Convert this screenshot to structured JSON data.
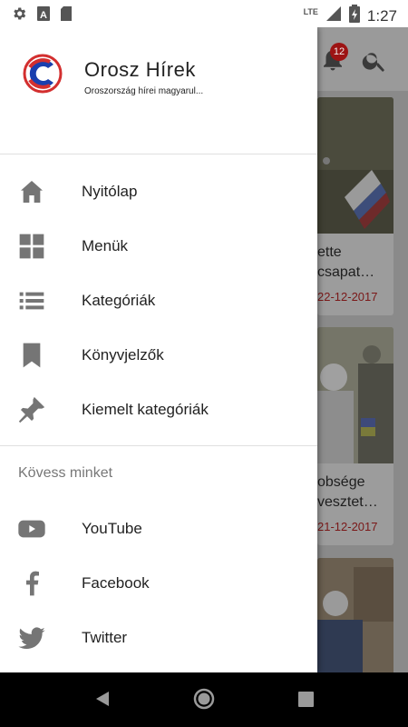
{
  "status_bar": {
    "time": "1:27",
    "network": "LTE",
    "left_icons": [
      "gear-icon",
      "text-a-icon",
      "sd-card-icon"
    ],
    "right_icons": [
      "signal-icon",
      "battery-icon"
    ]
  },
  "drawer": {
    "app_title": "Orosz Hírek",
    "app_subtitle": "Oroszország hírei magyarul...",
    "menu": [
      {
        "label": "Nyitólap",
        "icon": "home-icon"
      },
      {
        "label": "Menük",
        "icon": "grid-icon"
      },
      {
        "label": "Kategóriák",
        "icon": "list-icon"
      },
      {
        "label": "Könyvjelzők",
        "icon": "bookmark-icon"
      },
      {
        "label": "Kiemelt kategóriák",
        "icon": "pin-icon"
      }
    ],
    "follow_title": "Kövess minket",
    "social": [
      {
        "label": "YouTube",
        "icon": "youtube-icon"
      },
      {
        "label": "Facebook",
        "icon": "facebook-icon"
      },
      {
        "label": "Twitter",
        "icon": "twitter-icon"
      }
    ]
  },
  "background": {
    "notification_count": "12",
    "cards": [
      {
        "title_line1": "ette",
        "title_line2": "csapat…",
        "date": "22-12-2017"
      },
      {
        "title_line1": "obsége",
        "title_line2": "vesztet…",
        "date": "21-12-2017"
      },
      {
        "title_line1": "",
        "title_line2": "",
        "date": ""
      }
    ]
  },
  "colors": {
    "accent_red": "#c62828",
    "icon_grey": "#757575",
    "drawer_bg": "#ffffff",
    "scrim": "#8a8a8a"
  }
}
